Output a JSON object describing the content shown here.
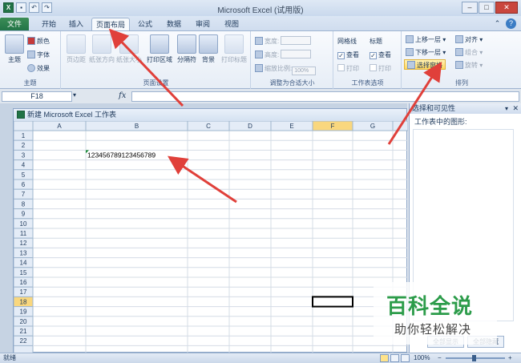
{
  "window": {
    "title": "Microsoft Excel (试用版)",
    "min": "–",
    "restore": "□",
    "close": "✕"
  },
  "tabs": [
    {
      "label": "文件"
    },
    {
      "label": "开始"
    },
    {
      "label": "插入"
    },
    {
      "label": "页面布局"
    },
    {
      "label": "公式"
    },
    {
      "label": "数据"
    },
    {
      "label": "审阅"
    },
    {
      "label": "视图"
    }
  ],
  "ribbon": {
    "theme": {
      "big": "主题",
      "colors": "颜色",
      "fonts": "字体",
      "effects": "效果",
      "label": "主题"
    },
    "page_setup": {
      "margins": "页边距",
      "orientation": "纸张方向",
      "size": "纸张大小",
      "print_area": "打印区域",
      "breaks": "分隔符",
      "background": "背景",
      "print_titles": "打印标题",
      "label": "页面设置"
    },
    "scale": {
      "width": "宽度:",
      "height": "高度:",
      "scale": "缩放比例:",
      "scale_value": "100%",
      "label": "调整为合适大小"
    },
    "sheet_options": {
      "gridlines": "网格线",
      "headings": "标题",
      "view": "查看",
      "print": "打印",
      "label": "工作表选项"
    },
    "arrange": {
      "bring_forward": "上移一层",
      "send_backward": "下移一层",
      "selection_pane": "选择窗格",
      "align": "对齐",
      "group": "组合",
      "rotate": "旋转",
      "label": "排列"
    }
  },
  "formula_bar": {
    "name_box": "F18",
    "fx": "fx",
    "value": ""
  },
  "sheet": {
    "window_title": "新建 Microsoft Excel 工作表",
    "columns": [
      "A",
      "B",
      "C",
      "D",
      "E",
      "F",
      "G"
    ],
    "rows": [
      "1",
      "2",
      "3",
      "4",
      "5",
      "6",
      "7",
      "8",
      "9",
      "10",
      "11",
      "12",
      "13",
      "14",
      "15",
      "16",
      "17",
      "18",
      "19",
      "20",
      "21",
      "22"
    ],
    "cell_b3": "123456789123456789",
    "active_row": "18",
    "active_col": "F"
  },
  "pane": {
    "title": "选择和可见性",
    "subtitle": "工作表中的图形:",
    "show_all": "全部显示",
    "hide_all": "全部隐藏"
  },
  "status": {
    "ready": "就绪",
    "zoom": "100%",
    "minus": "−",
    "plus": "+"
  },
  "watermark": {
    "title": "百科全说",
    "subtitle": "助你轻松解决"
  }
}
